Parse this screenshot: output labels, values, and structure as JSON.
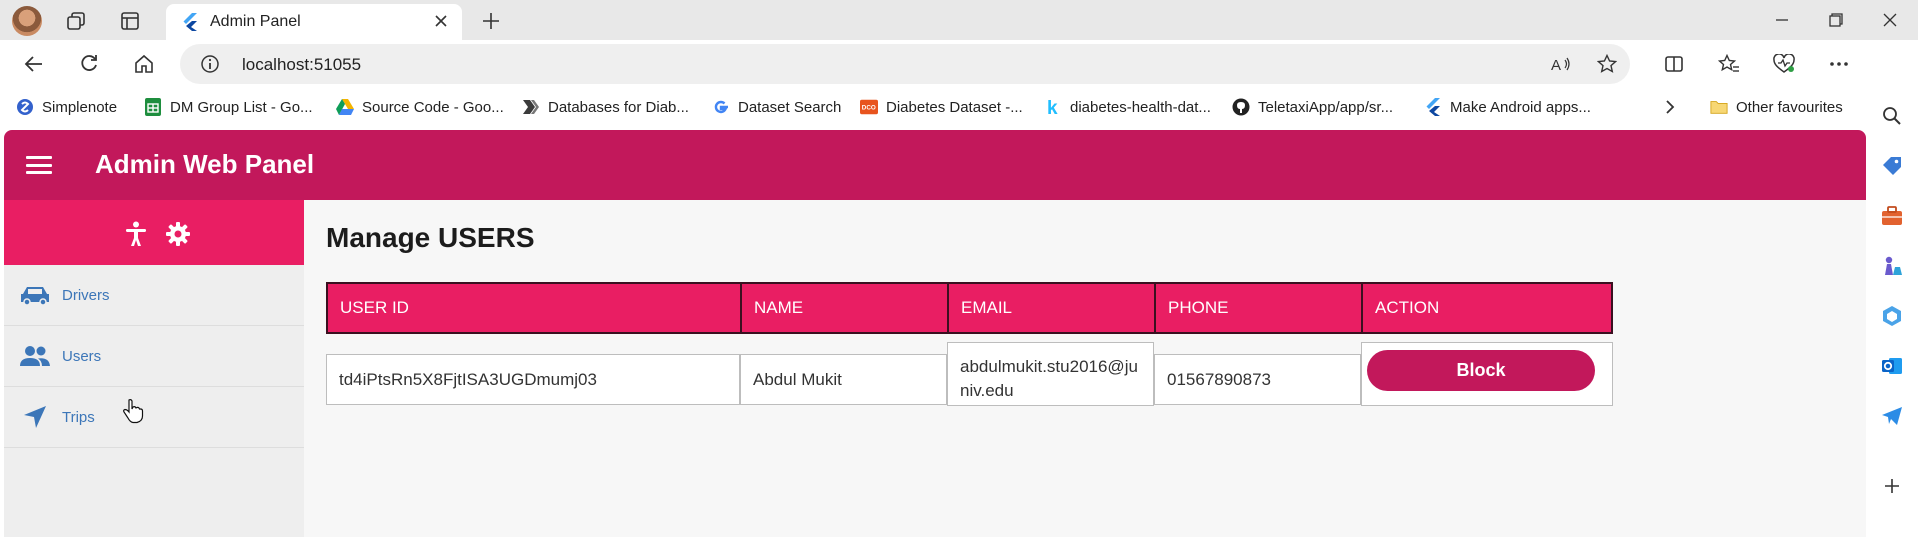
{
  "browser": {
    "tab_title": "Admin Panel",
    "url": "localhost:51055",
    "bookmarks": [
      {
        "label": "Simplenote",
        "icon": "simplenote-icon",
        "color": "#3361cc"
      },
      {
        "label": "DM Group List - Go...",
        "icon": "sheets-icon",
        "color": "#1e8e3e"
      },
      {
        "label": "Source Code - Goo...",
        "icon": "drive-icon",
        "color": "#f4b400"
      },
      {
        "label": "Databases for Diab...",
        "icon": "bookmark-icon",
        "color": "#444444"
      },
      {
        "label": "Dataset Search",
        "icon": "google-icon",
        "color": "#4285f4"
      },
      {
        "label": "Diabetes Dataset -...",
        "icon": "dataset-icon",
        "color": "#e8541e"
      },
      {
        "label": "diabetes-health-dat...",
        "icon": "kaggle-icon",
        "color": "#20beff"
      },
      {
        "label": "TeletaxiApp/app/sr...",
        "icon": "github-icon",
        "color": "#222222"
      },
      {
        "label": "Make Android apps...",
        "icon": "flutter-icon",
        "color": "#42a5f5"
      }
    ],
    "other_favourites": "Other favourites"
  },
  "app": {
    "title": "Admin Web Panel",
    "colors": {
      "appbar": "#c2185b",
      "accent": "#e91e63",
      "link": "#3c76b8"
    }
  },
  "sidebar": {
    "items": [
      {
        "label": "Drivers",
        "icon": "car-icon"
      },
      {
        "label": "Users",
        "icon": "people-icon"
      },
      {
        "label": "Trips",
        "icon": "navigation-icon"
      }
    ]
  },
  "main": {
    "title": "Manage USERS",
    "columns": [
      "USER ID",
      "NAME",
      "EMAIL",
      "PHONE",
      "ACTION"
    ],
    "rows": [
      {
        "user_id": "td4iPtsRn5X8FjtISA3UGDmumj03",
        "name": "Abdul Mukit",
        "email": "abdulmukit.stu2016@juniv.edu",
        "phone": "01567890873",
        "action": "Block"
      }
    ]
  }
}
